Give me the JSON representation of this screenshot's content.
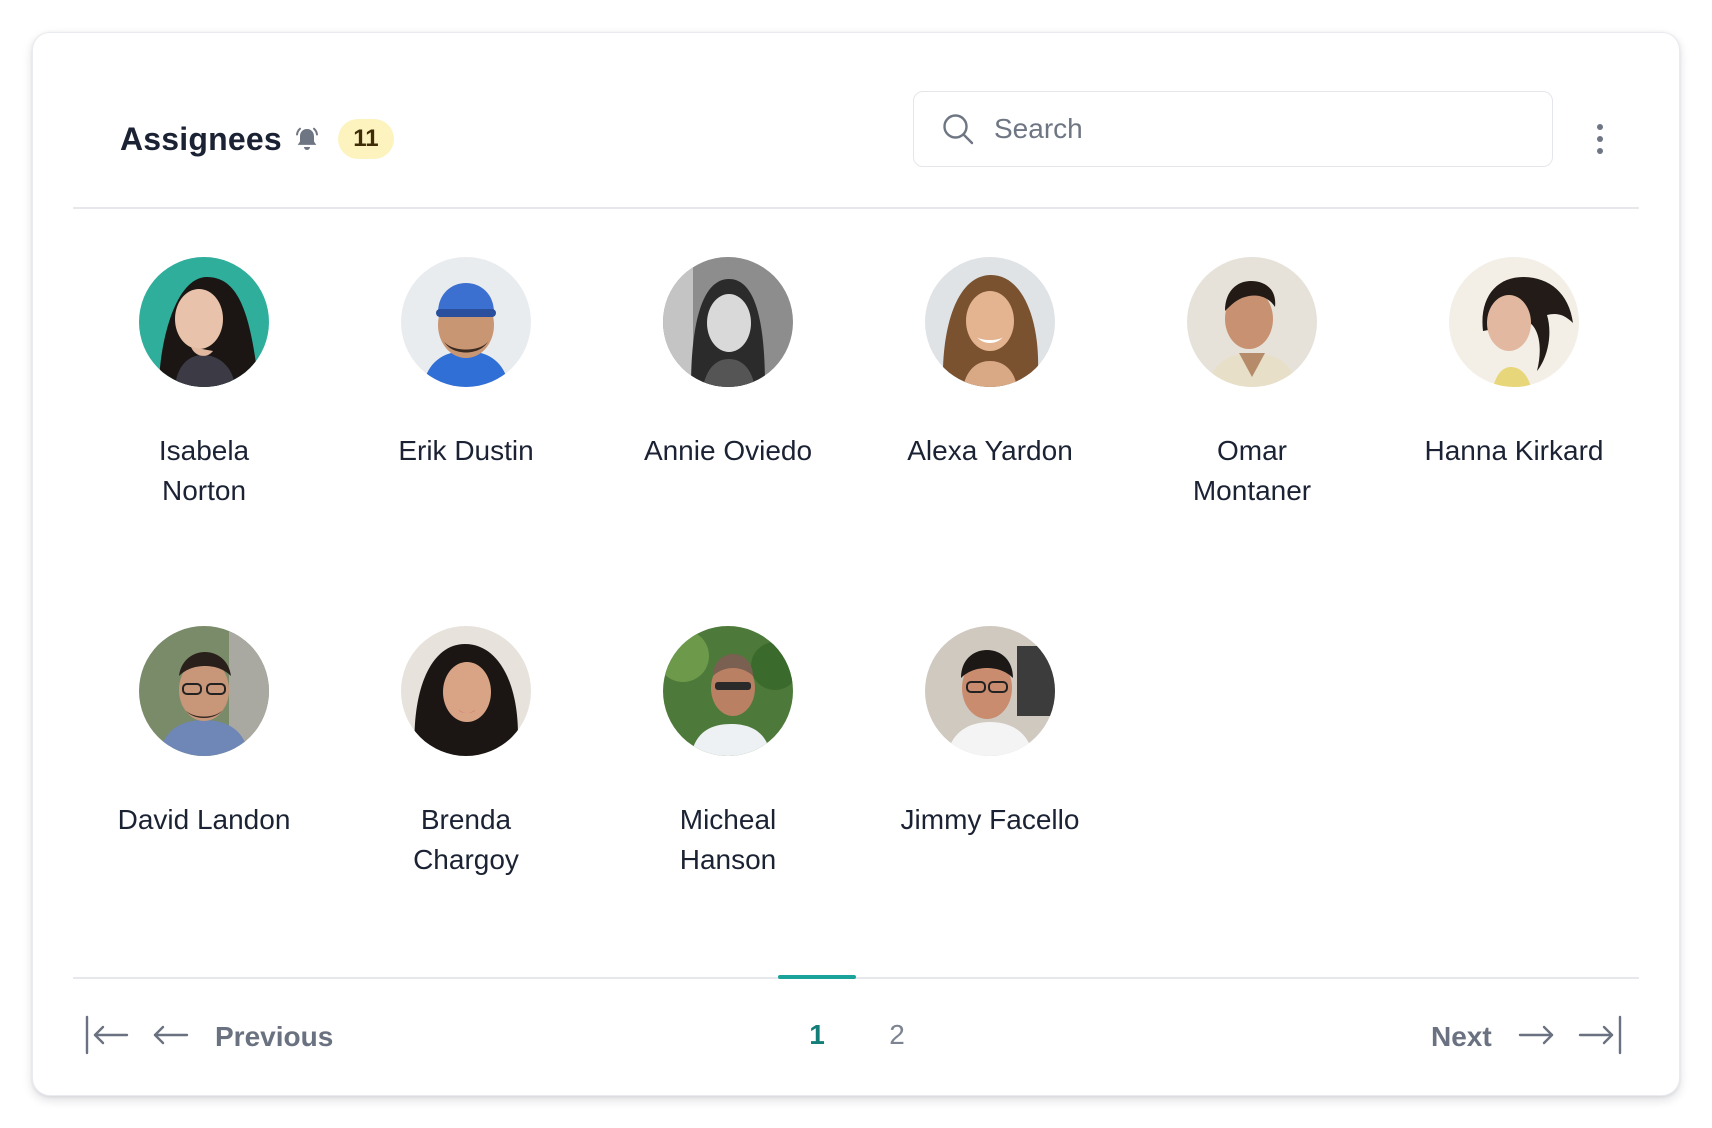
{
  "header": {
    "title": "Assignees",
    "bell_icon": "bell-ringing-icon",
    "count": "11",
    "badge_color": "#fdf3bf",
    "search_placeholder": "Search",
    "search_value": "",
    "menu_icon": "vertical-ellipsis-icon"
  },
  "assignees": [
    {
      "line1": "Isabela",
      "line2": "Norton",
      "avatar_bg": "#2fae9c"
    },
    {
      "line1": "Erik Dustin",
      "line2": "",
      "avatar_bg": "#e9ecef"
    },
    {
      "line1": "Annie Oviedo",
      "line2": "",
      "avatar_bg": "#8d8d8d"
    },
    {
      "line1": "Alexa Yardon",
      "line2": "",
      "avatar_bg": "#dfe3e6"
    },
    {
      "line1": "Omar",
      "line2": "Montaner",
      "avatar_bg": "#e6e2da"
    },
    {
      "line1": "Hanna Kirkard",
      "line2": "",
      "avatar_bg": "#f3efe6"
    },
    {
      "line1": "David Landon",
      "line2": "",
      "avatar_bg": "#7a8b6a"
    },
    {
      "line1": "Brenda",
      "line2": "Chargoy",
      "avatar_bg": "#e7e2dc"
    },
    {
      "line1": "Micheal",
      "line2": "Hanson",
      "avatar_bg": "#4d7a3a"
    },
    {
      "line1": "Jimmy Facello",
      "line2": "",
      "avatar_bg": "#cfc9c0"
    }
  ],
  "pagination": {
    "previous_label": "Previous",
    "next_label": "Next",
    "pages": [
      "1",
      "2"
    ],
    "current_page": "1",
    "accent_color": "#1aa39a"
  }
}
